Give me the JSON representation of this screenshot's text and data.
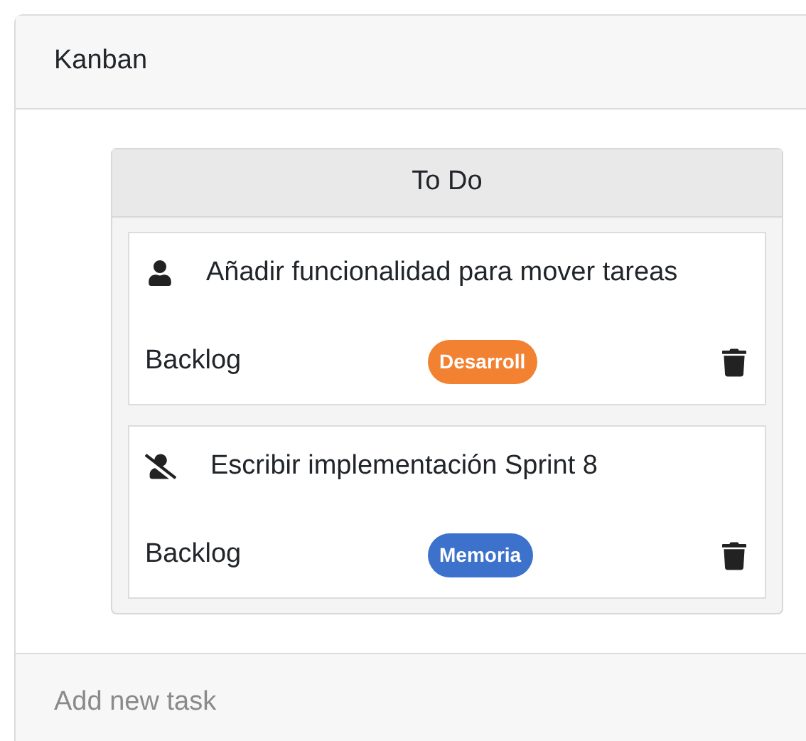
{
  "header": {
    "title": "Kanban"
  },
  "column": {
    "title": "To Do",
    "tasks": [
      {
        "assigned": true,
        "title": "Añadir funcionalidad para mover tareas",
        "status": "Backlog",
        "tag": {
          "label": "Desarroll",
          "color": "#f28132"
        }
      },
      {
        "assigned": false,
        "title": "Escribir implementación Sprint 8",
        "status": "Backlog",
        "tag": {
          "label": "Memoria",
          "color": "#3d72cc"
        }
      }
    ]
  },
  "footer": {
    "label": "Add new task"
  }
}
